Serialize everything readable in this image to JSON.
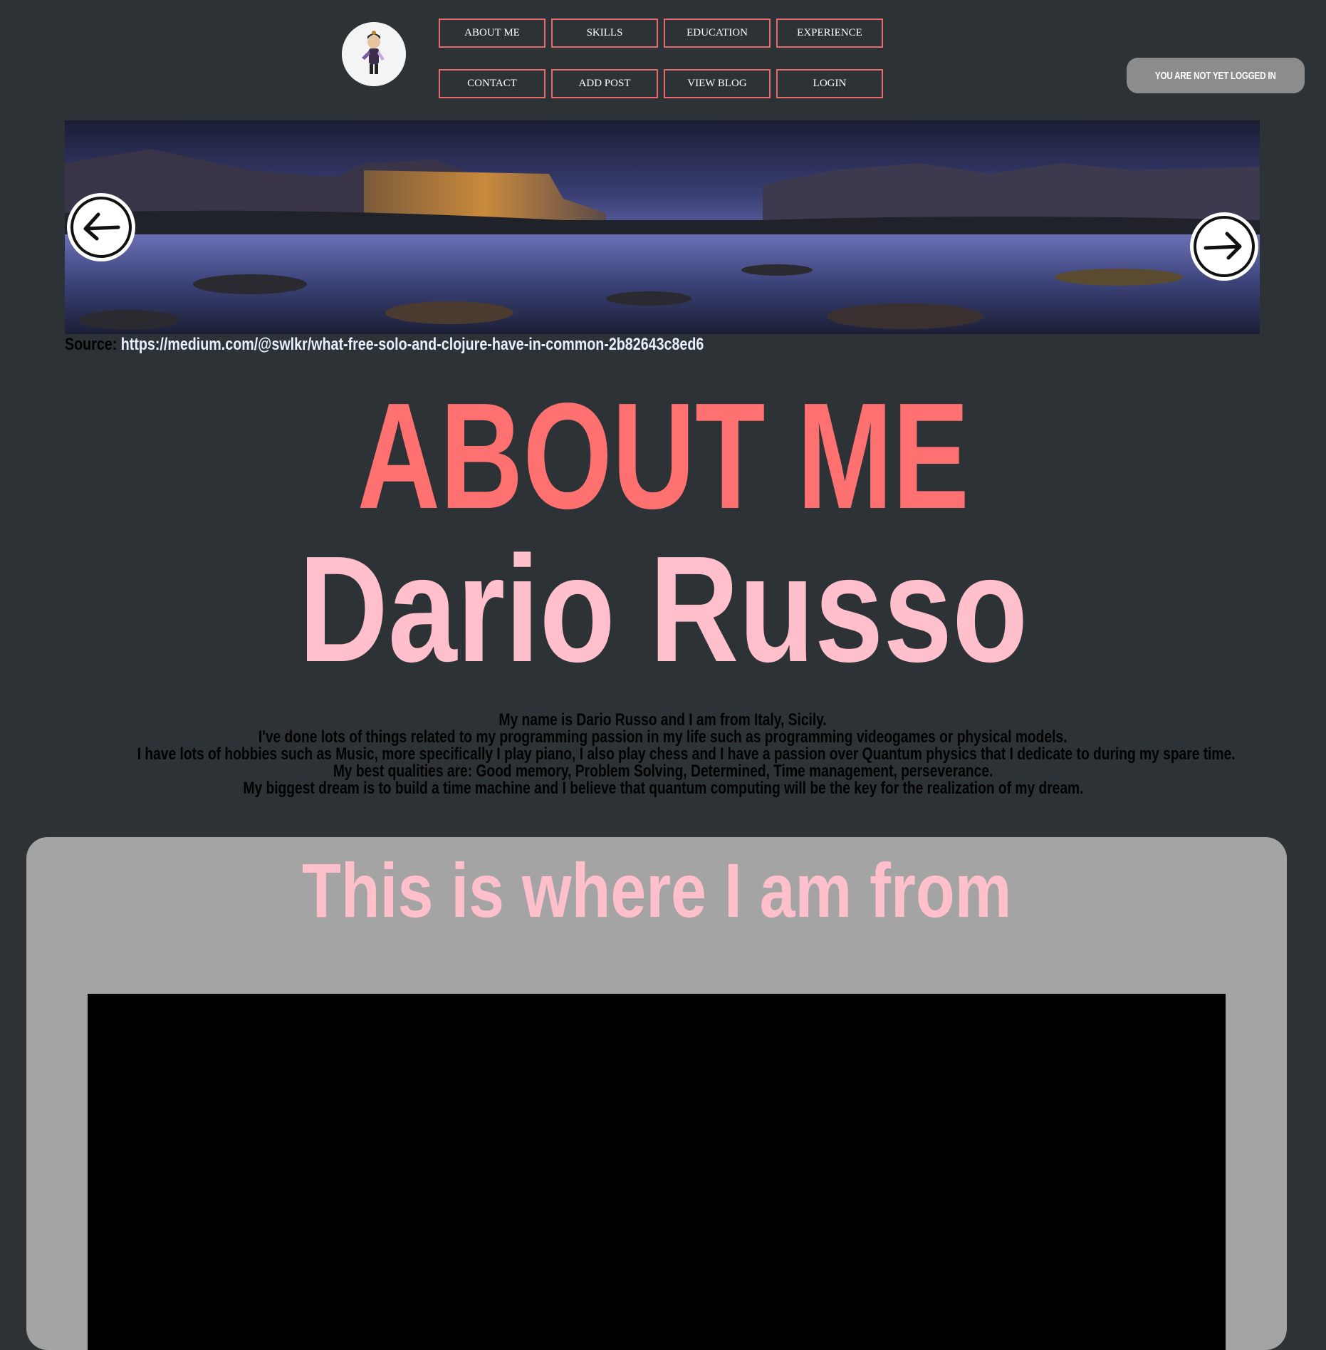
{
  "header": {
    "nav": [
      {
        "label": "ABOUT ME"
      },
      {
        "label": "SKILLS"
      },
      {
        "label": "EDUCATION"
      },
      {
        "label": "EXPERIENCE"
      },
      {
        "label": "CONTACT"
      },
      {
        "label": "ADD POST"
      },
      {
        "label": "VIEW BLOG"
      },
      {
        "label": "LOGIN"
      }
    ],
    "login_status": "YOU ARE NOT YET LOGGED IN"
  },
  "banner": {
    "source_label": "Source:",
    "source_url": "https://medium.com/@swlkr/what-free-solo-and-clojure-have-in-common-2b82643c8ed6"
  },
  "about": {
    "heading": "ABOUT ME",
    "name": "Dario Russo",
    "bio": [
      "My name is Dario Russo and I am from Italy, Sicily.",
      "I've done lots of things related to my programming passion in my life such as programming videogames or physical models.",
      "I have lots of hobbies such as Music, more specifically I play piano, I also play chess and I have a passion over Quantum physics that I dedicate to during my spare time.",
      "My best qualities are: Good memory, Problem Solving, Determined, Time management, perseverance.",
      "My biggest dream is to build a time machine and I believe that quantum computing will be the key for the realization of my dream."
    ]
  },
  "location": {
    "title": "This is where I am from"
  },
  "colors": {
    "background": "#2c3235",
    "accent_red": "#ff7070",
    "accent_pink": "#ffc0cb",
    "nav_border": "#e46b6b",
    "card": "#a4a4a4"
  }
}
